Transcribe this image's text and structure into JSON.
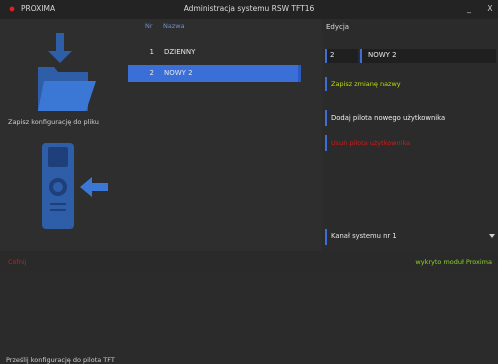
{
  "window": {
    "app_name": "PROXIMA",
    "title": "Administracja systemu RSW TFT16",
    "minimize_label": "_",
    "close_label": "X"
  },
  "left_panel": {
    "save_config_label": "Zapisz konfigurację do pliku",
    "send_config_label": "Prześlij konfigurację do pilota TFT"
  },
  "list": {
    "col_nr": "Nr",
    "col_name": "Nazwa",
    "rows": [
      {
        "nr": "1",
        "name": "DZIENNY"
      },
      {
        "nr": "2",
        "name": "NOWY 2"
      }
    ],
    "selected_index": 1
  },
  "edit": {
    "title": "Edycja",
    "nr_value": "2",
    "name_value": "NOWY 2",
    "save_name_label": "Zapisz zmianę nazwy",
    "add_remote_label": "Dodaj pilota nowego użytkownika",
    "delete_remote_label": "Usuń pilota użytkownika",
    "channel_selected": "Kanał systemu nr 1"
  },
  "status": {
    "left_text": "Cofnij",
    "right_text": "wykryto moduł Proxima"
  },
  "colors": {
    "accent_blue": "#3a6fd8",
    "header_blue": "#6f8fc8",
    "save_green": "#b6e000",
    "status_green": "#8ad61f",
    "danger_red": "#c81e1e",
    "icon_blue": "#2f5ea8"
  },
  "icons": {
    "app": "red-dot-icon",
    "save": "folder-download-icon",
    "send": "remote-arrow-icon"
  }
}
